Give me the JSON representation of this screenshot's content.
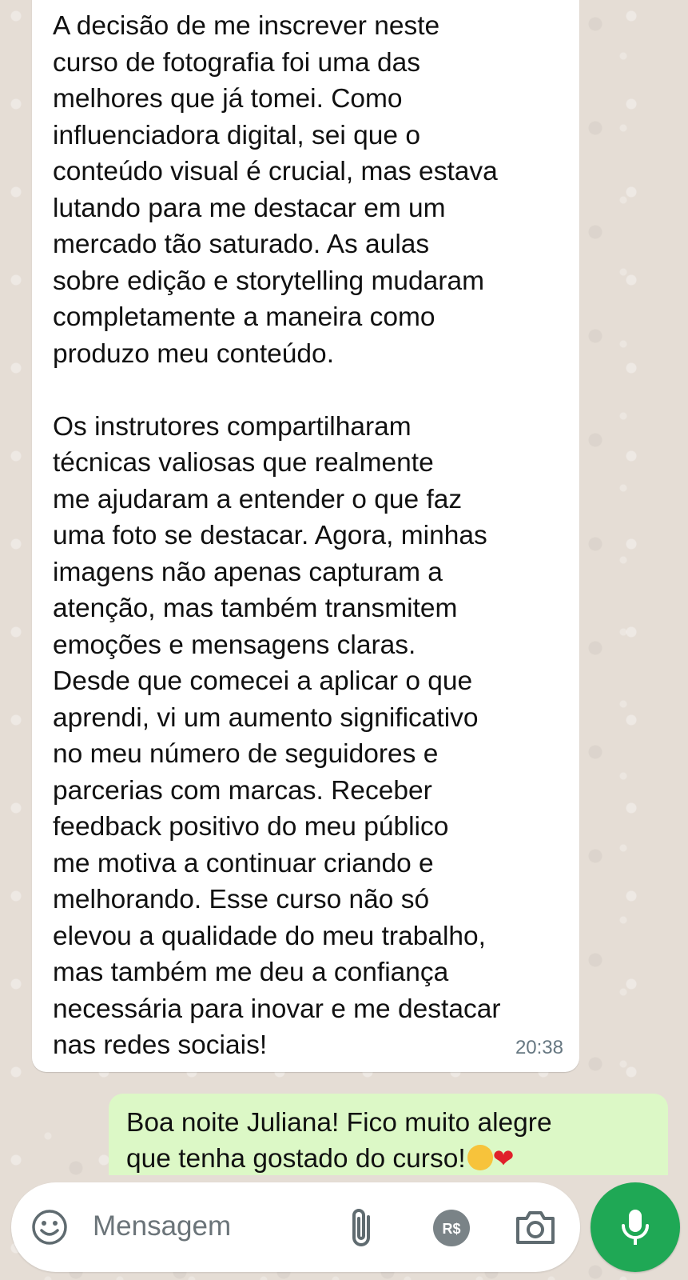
{
  "conversation": {
    "incoming": {
      "text": "A decisão de me inscrever neste\ncurso de fotografia foi uma das\nmelhores que já tomei. Como\ninfluenciadora digital, sei que o\nconteúdo visual é crucial, mas estava\nlutando para me destacar em um\nmercado tão saturado. As aulas\nsobre edição e storytelling mudaram\ncompletamente a maneira como\nproduzo meu conteúdo.\n\nOs instrutores compartilharam\ntécnicas valiosas que realmente\nme ajudaram a entender o que faz\numa foto se destacar. Agora, minhas\nimagens não apenas capturam a\natenção, mas também transmitem\nemoções e mensagens claras.\nDesde que comecei a aplicar o que\naprendi, vi um aumento significativo\nno meu número de seguidores e\nparcerias com marcas. Receber\nfeedback positivo do meu público\nme motiva a continuar criando e\nmelhorando. Esse curso não só\nelevou a qualidade do meu trabalho,\nmas também me deu a confiança\nnecessária para inovar e me destacar\nnas redes sociais!",
      "time": "20:38"
    },
    "outgoing": {
      "line1": "Boa noite Juliana! Fico muito alegre",
      "line2": "que tenha gostado do curso!"
    }
  },
  "composer": {
    "placeholder": "Mensagem",
    "emoji_icon": "emoji-icon",
    "attach_icon": "paperclip-icon",
    "payment_icon": "payment-icon",
    "payment_label": "R$",
    "camera_icon": "camera-icon",
    "mic_icon": "microphone-icon"
  },
  "colors": {
    "incoming_bubble": "#ffffff",
    "outgoing_bubble": "#dcf8c6",
    "mic_button": "#1fa855",
    "icon_gray": "#5f6b70"
  }
}
